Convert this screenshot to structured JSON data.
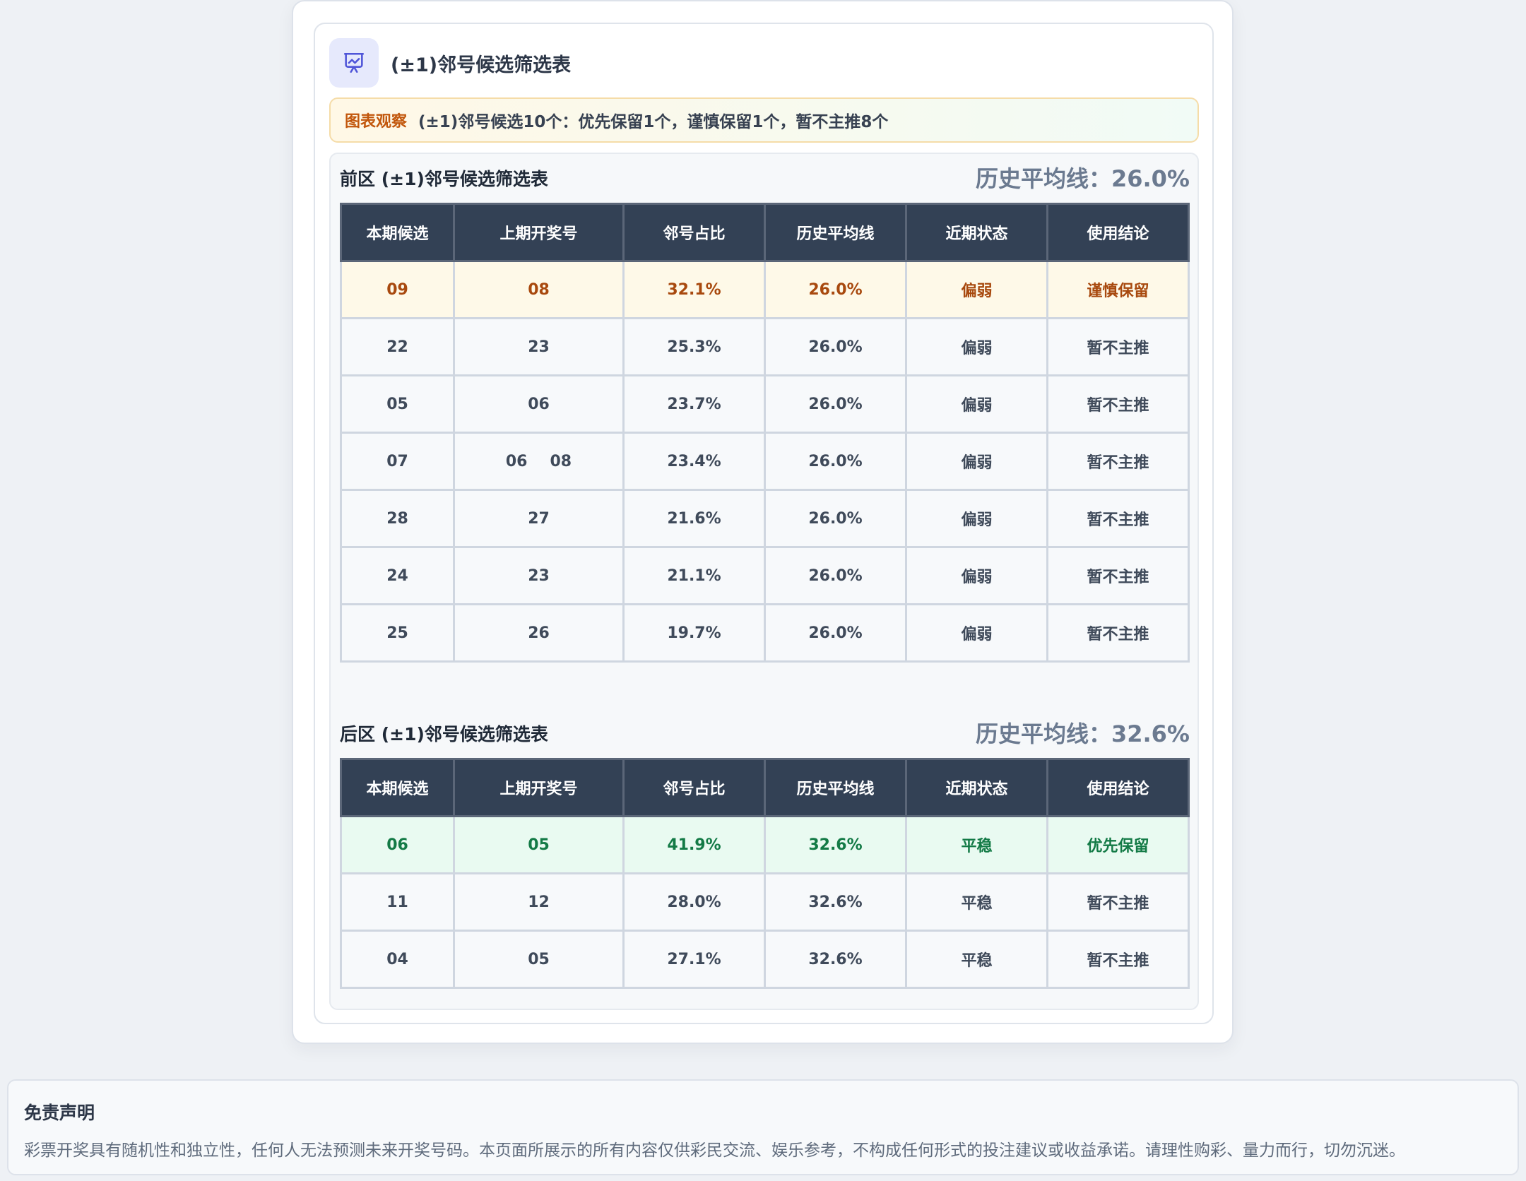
{
  "card": {
    "icon": "presentation-chart-icon",
    "title": "(±1)邻号候选筛选表",
    "observation_label": "图表观察",
    "observation_text": "(±1)邻号候选10个：优先保留1个，谨慎保留1个，暂不主推8个"
  },
  "colors": {
    "header_bg": "#334155",
    "icon_bg": "#e6e9fc",
    "icon_stroke": "#4f55d8",
    "warn_row_bg": "#fef9e8",
    "warn_text": "#a8490e",
    "good_row_bg": "#e9faf1",
    "good_text": "#137a46",
    "observation_label": "#c2570c"
  },
  "columns": [
    "本期候选",
    "上期开奖号",
    "邻号占比",
    "历史平均线",
    "近期状态",
    "使用结论"
  ],
  "front": {
    "title": "前区 (±1)邻号候选筛选表",
    "avg_label": "历史平均线：26.0%",
    "rows": [
      {
        "candidate": "09",
        "prev": [
          "08"
        ],
        "ratio": "32.1%",
        "avg": "26.0%",
        "status": "偏弱",
        "conclusion": "谨慎保留",
        "highlight": "warn"
      },
      {
        "candidate": "22",
        "prev": [
          "23"
        ],
        "ratio": "25.3%",
        "avg": "26.0%",
        "status": "偏弱",
        "conclusion": "暂不主推",
        "highlight": ""
      },
      {
        "candidate": "05",
        "prev": [
          "06"
        ],
        "ratio": "23.7%",
        "avg": "26.0%",
        "status": "偏弱",
        "conclusion": "暂不主推",
        "highlight": ""
      },
      {
        "candidate": "07",
        "prev": [
          "06",
          "08"
        ],
        "ratio": "23.4%",
        "avg": "26.0%",
        "status": "偏弱",
        "conclusion": "暂不主推",
        "highlight": ""
      },
      {
        "candidate": "28",
        "prev": [
          "27"
        ],
        "ratio": "21.6%",
        "avg": "26.0%",
        "status": "偏弱",
        "conclusion": "暂不主推",
        "highlight": ""
      },
      {
        "candidate": "24",
        "prev": [
          "23"
        ],
        "ratio": "21.1%",
        "avg": "26.0%",
        "status": "偏弱",
        "conclusion": "暂不主推",
        "highlight": ""
      },
      {
        "candidate": "25",
        "prev": [
          "26"
        ],
        "ratio": "19.7%",
        "avg": "26.0%",
        "status": "偏弱",
        "conclusion": "暂不主推",
        "highlight": ""
      }
    ]
  },
  "back": {
    "title": "后区 (±1)邻号候选筛选表",
    "avg_label": "历史平均线：32.6%",
    "rows": [
      {
        "candidate": "06",
        "prev": [
          "05"
        ],
        "ratio": "41.9%",
        "avg": "32.6%",
        "status": "平稳",
        "conclusion": "优先保留",
        "highlight": "good"
      },
      {
        "candidate": "11",
        "prev": [
          "12"
        ],
        "ratio": "28.0%",
        "avg": "32.6%",
        "status": "平稳",
        "conclusion": "暂不主推",
        "highlight": ""
      },
      {
        "candidate": "04",
        "prev": [
          "05"
        ],
        "ratio": "27.1%",
        "avg": "32.6%",
        "status": "平稳",
        "conclusion": "暂不主推",
        "highlight": ""
      }
    ]
  },
  "disclaimer": {
    "title": "免责声明",
    "text": "彩票开奖具有随机性和独立性，任何人无法预测未来开奖号码。本页面所展示的所有内容仅供彩民交流、娱乐参考，不构成任何形式的投注建议或收益承诺。请理性购彩、量力而行，切勿沉迷。"
  }
}
